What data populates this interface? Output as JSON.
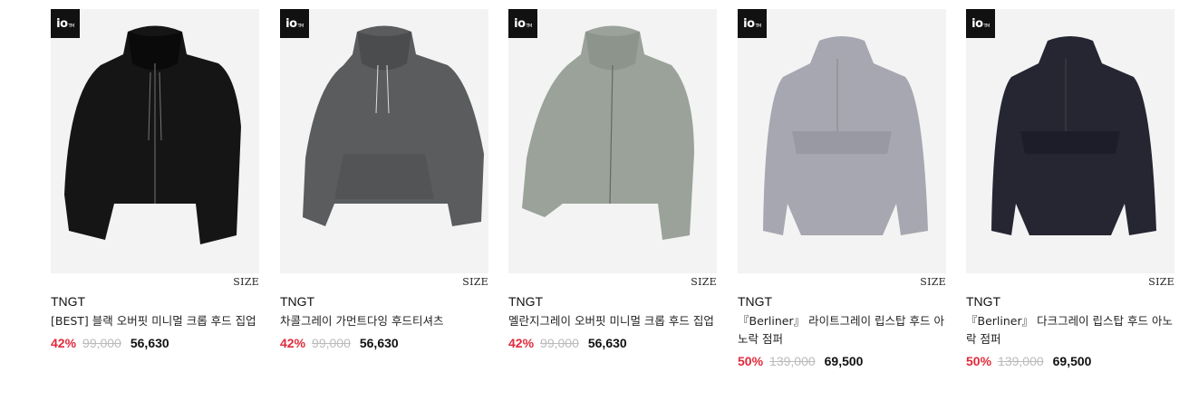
{
  "colors": {
    "discount": "#e02a3b",
    "original_price": "#bbbbbb",
    "image_bg": "#f3f3f3"
  },
  "products": [
    {
      "badge": "io",
      "badge_sub": "TM",
      "size_label": "SIZE",
      "brand": "TNGT",
      "name": "[BEST] 블랙 오버핏 미니멀 크롭 후드 집업",
      "discount": "42%",
      "original_price": "99,000",
      "price": "56,630",
      "image_icon": "black-zip-hoodie"
    },
    {
      "badge": "io",
      "badge_sub": "TM",
      "size_label": "SIZE",
      "brand": "TNGT",
      "name": "차콜그레이 가먼트다잉 후드티셔츠",
      "discount": "42%",
      "original_price": "99,000",
      "price": "56,630",
      "image_icon": "charcoal-hoodie"
    },
    {
      "badge": "io",
      "badge_sub": "TM",
      "size_label": "SIZE",
      "brand": "TNGT",
      "name": "멜란지그레이 오버핏 미니멀 크롭 후드 집업",
      "discount": "42%",
      "original_price": "99,000",
      "price": "56,630",
      "image_icon": "grey-zip-hoodie"
    },
    {
      "badge": "io",
      "badge_sub": "TM",
      "size_label": "SIZE",
      "brand": "TNGT",
      "name": "『Berliner』 라이트그레이 립스탑 후드 아노락 점퍼",
      "discount": "50%",
      "original_price": "139,000",
      "price": "69,500",
      "image_icon": "lightgrey-anorak"
    },
    {
      "badge": "io",
      "badge_sub": "TM",
      "size_label": "SIZE",
      "brand": "TNGT",
      "name": "『Berliner』 다크그레이 립스탑 후드 아노락 점퍼",
      "discount": "50%",
      "original_price": "139,000",
      "price": "69,500",
      "image_icon": "darkgrey-anorak"
    }
  ]
}
